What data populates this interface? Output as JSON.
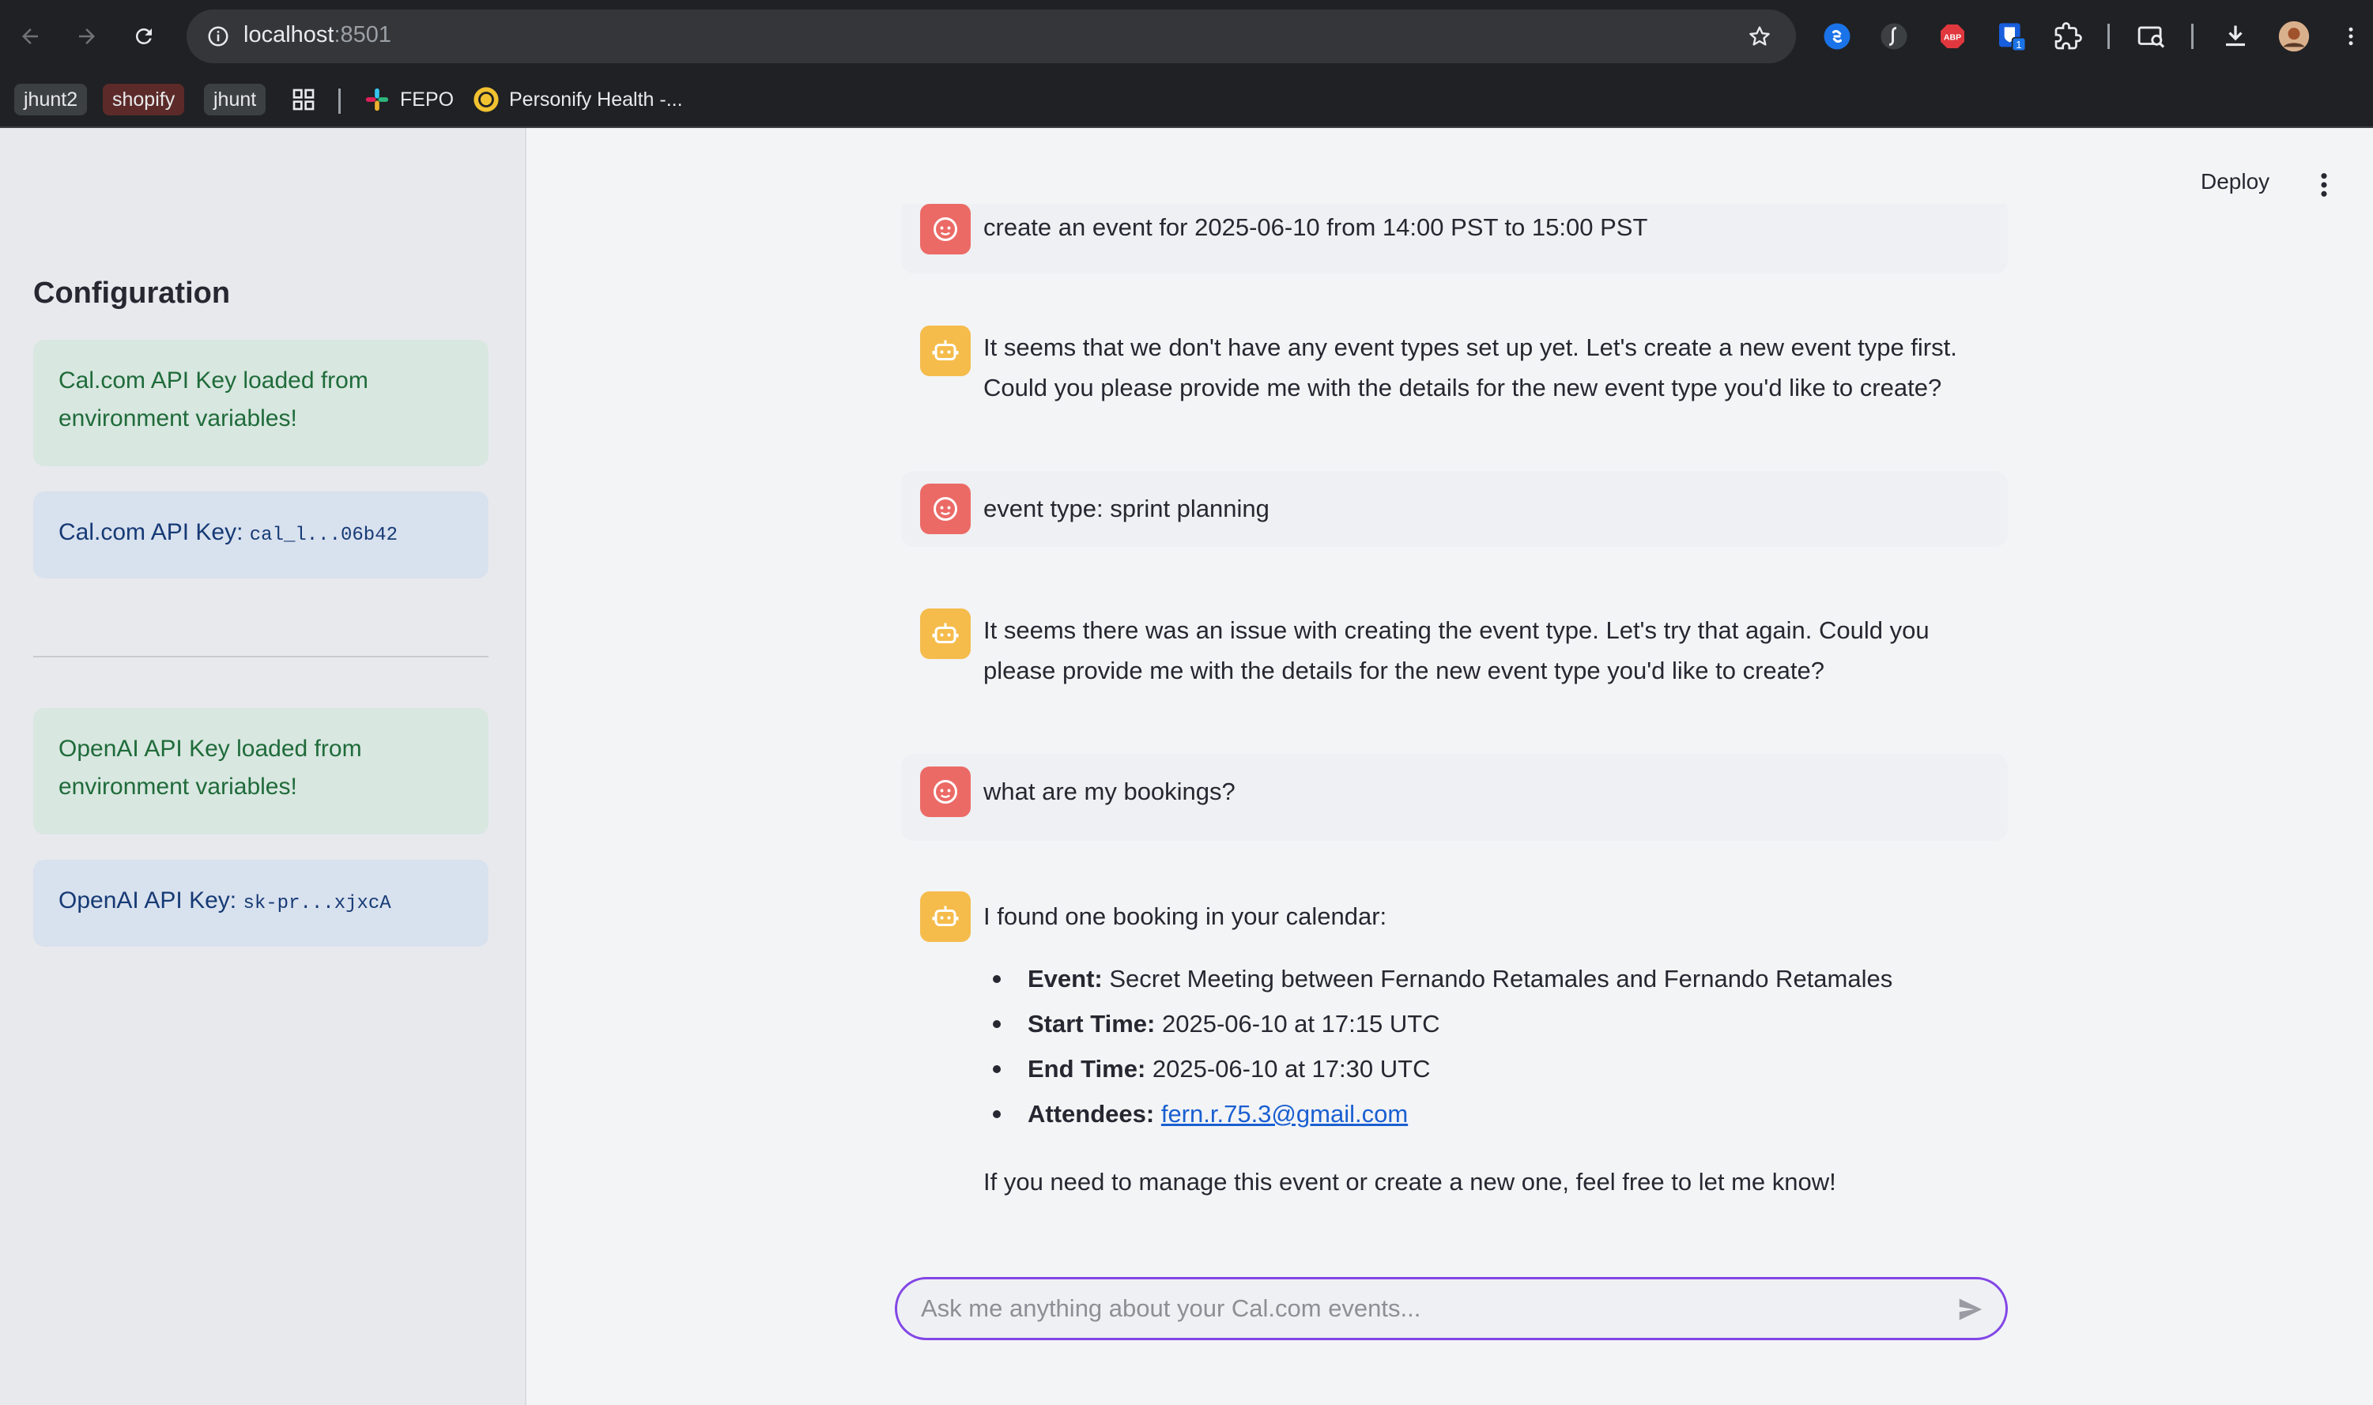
{
  "browser": {
    "url_host": "localhost",
    "url_port": ":8501",
    "bookmarks": {
      "chip1": "jhunt2",
      "chip2": "shopify",
      "chip3": "jhunt",
      "item1": "FEPO",
      "item2": "Personify Health -..."
    },
    "extension_badge": "1",
    "abp_label": "ABP"
  },
  "sidebar": {
    "title": "Configuration",
    "cal_loaded": "Cal.com API Key loaded from environment variables!",
    "cal_key_label": "Cal.com API Key: ",
    "cal_key_value": "cal_l...06b42",
    "openai_loaded": "OpenAI API Key loaded from environment variables!",
    "openai_key_label": "OpenAI API Key: ",
    "openai_key_value": "sk-pr...xjxcA"
  },
  "header": {
    "deploy_label": "Deploy"
  },
  "chat": {
    "messages": [
      {
        "role": "user",
        "text": "create an event for 2025-06-10 from 14:00 PST to 15:00 PST"
      },
      {
        "role": "assistant",
        "text": "It seems that we don't have any event types set up yet. Let's create a new event type first. Could you please provide me with the details for the new event type you'd like to create?"
      },
      {
        "role": "user",
        "text": "event type: sprint planning"
      },
      {
        "role": "assistant",
        "text": "It seems there was an issue with creating the event type. Let's try that again. Could you please provide me with the details for the new event type you'd like to create?"
      },
      {
        "role": "user",
        "text": "what are my bookings?"
      },
      {
        "role": "assistant",
        "intro": "I found one booking in your calendar:",
        "items": [
          {
            "label": "Event:",
            "value": "Secret Meeting between Fernando Retamales and Fernando Retamales"
          },
          {
            "label": "Start Time:",
            "value": "2025-06-10 at 17:15 UTC"
          },
          {
            "label": "End Time:",
            "value": "2025-06-10 at 17:30 UTC"
          },
          {
            "label": "Attendees:",
            "value": "fern.r.75.3@gmail.com"
          }
        ],
        "outro": "If you need to manage this event or create a new one, feel free to let me know!"
      }
    ],
    "input_placeholder": "Ask me anything about your Cal.com events...",
    "input_value": ""
  },
  "colors": {
    "user_avatar": "#ec6a66",
    "bot_avatar": "#f5bc4c",
    "input_border": "#8246e6",
    "link": "#1a5fd1"
  }
}
